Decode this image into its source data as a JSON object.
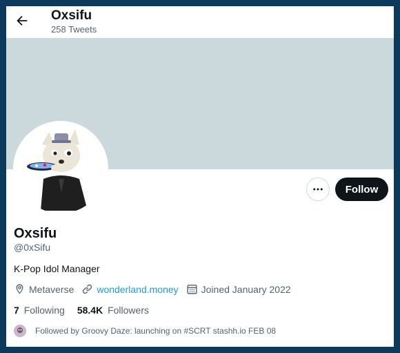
{
  "header": {
    "title": "Oxsifu",
    "tweet_count": "258 Tweets"
  },
  "profile": {
    "name": "Oxsifu",
    "handle": "@0xSifu",
    "bio": "K-Pop Idol Manager",
    "location": "Metaverse",
    "website": "wonderland.money",
    "joined": "Joined January 2022",
    "following_count": "7",
    "following_label": "Following",
    "followers_count": "58.4K",
    "followers_label": "Followers",
    "followed_by": "Followed by Groovy Daze: launching on #SCRT stashh.io FEB 08"
  },
  "actions": {
    "follow_label": "Follow"
  },
  "icons": {
    "back": "arrow-left-icon",
    "more": "more-horizontal-icon",
    "location": "location-pin-icon",
    "link": "link-icon",
    "calendar": "calendar-icon"
  },
  "colors": {
    "accent": "#1d9bf0",
    "banner": "#ccd9dc",
    "follow_bg": "#0f1419"
  }
}
